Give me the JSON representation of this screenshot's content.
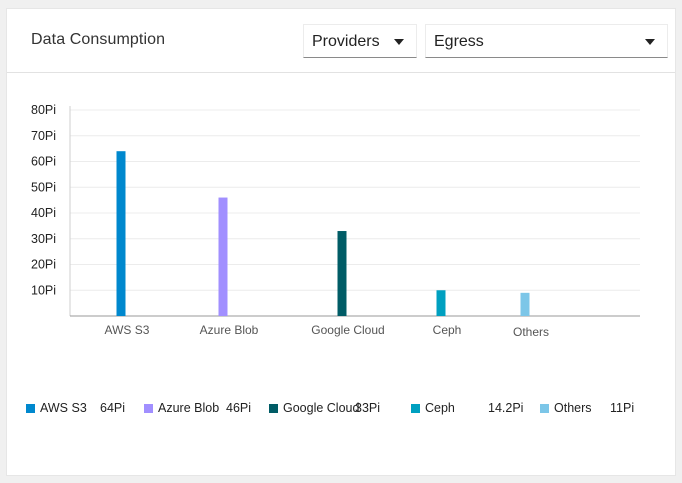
{
  "card": {
    "title": "Data Consumption"
  },
  "filters": {
    "provider": {
      "selected": "Providers"
    },
    "metric": {
      "selected": "Egress"
    }
  },
  "colors": {
    "AWS S3": "#0088ce",
    "Azure Blob": "#a18fff",
    "Google Cloud": "#005c66",
    "Ceph": "#00a0c0",
    "Others": "#7cc6e8"
  },
  "chart_data": {
    "type": "bar",
    "categories": [
      "AWS S3",
      "Azure Blob",
      "Google Cloud",
      "Ceph",
      "Others"
    ],
    "values": [
      64,
      46,
      33,
      10,
      9
    ],
    "yunit": "Pi",
    "ylim": [
      0,
      80
    ],
    "yticks": [
      "10Pi",
      "20Pi",
      "30Pi",
      "40Pi",
      "50Pi",
      "60Pi",
      "70Pi",
      "80Pi"
    ],
    "grid": true,
    "legend": [
      {
        "name": "AWS S3",
        "value": "64Pi"
      },
      {
        "name": "Azure Blob",
        "value": "46Pi"
      },
      {
        "name": "Google Cloud",
        "value": "33Pi"
      },
      {
        "name": "Ceph",
        "value": "14.2Pi"
      },
      {
        "name": "Others",
        "value": "11Pi"
      }
    ],
    "legend_position": "bottom"
  }
}
